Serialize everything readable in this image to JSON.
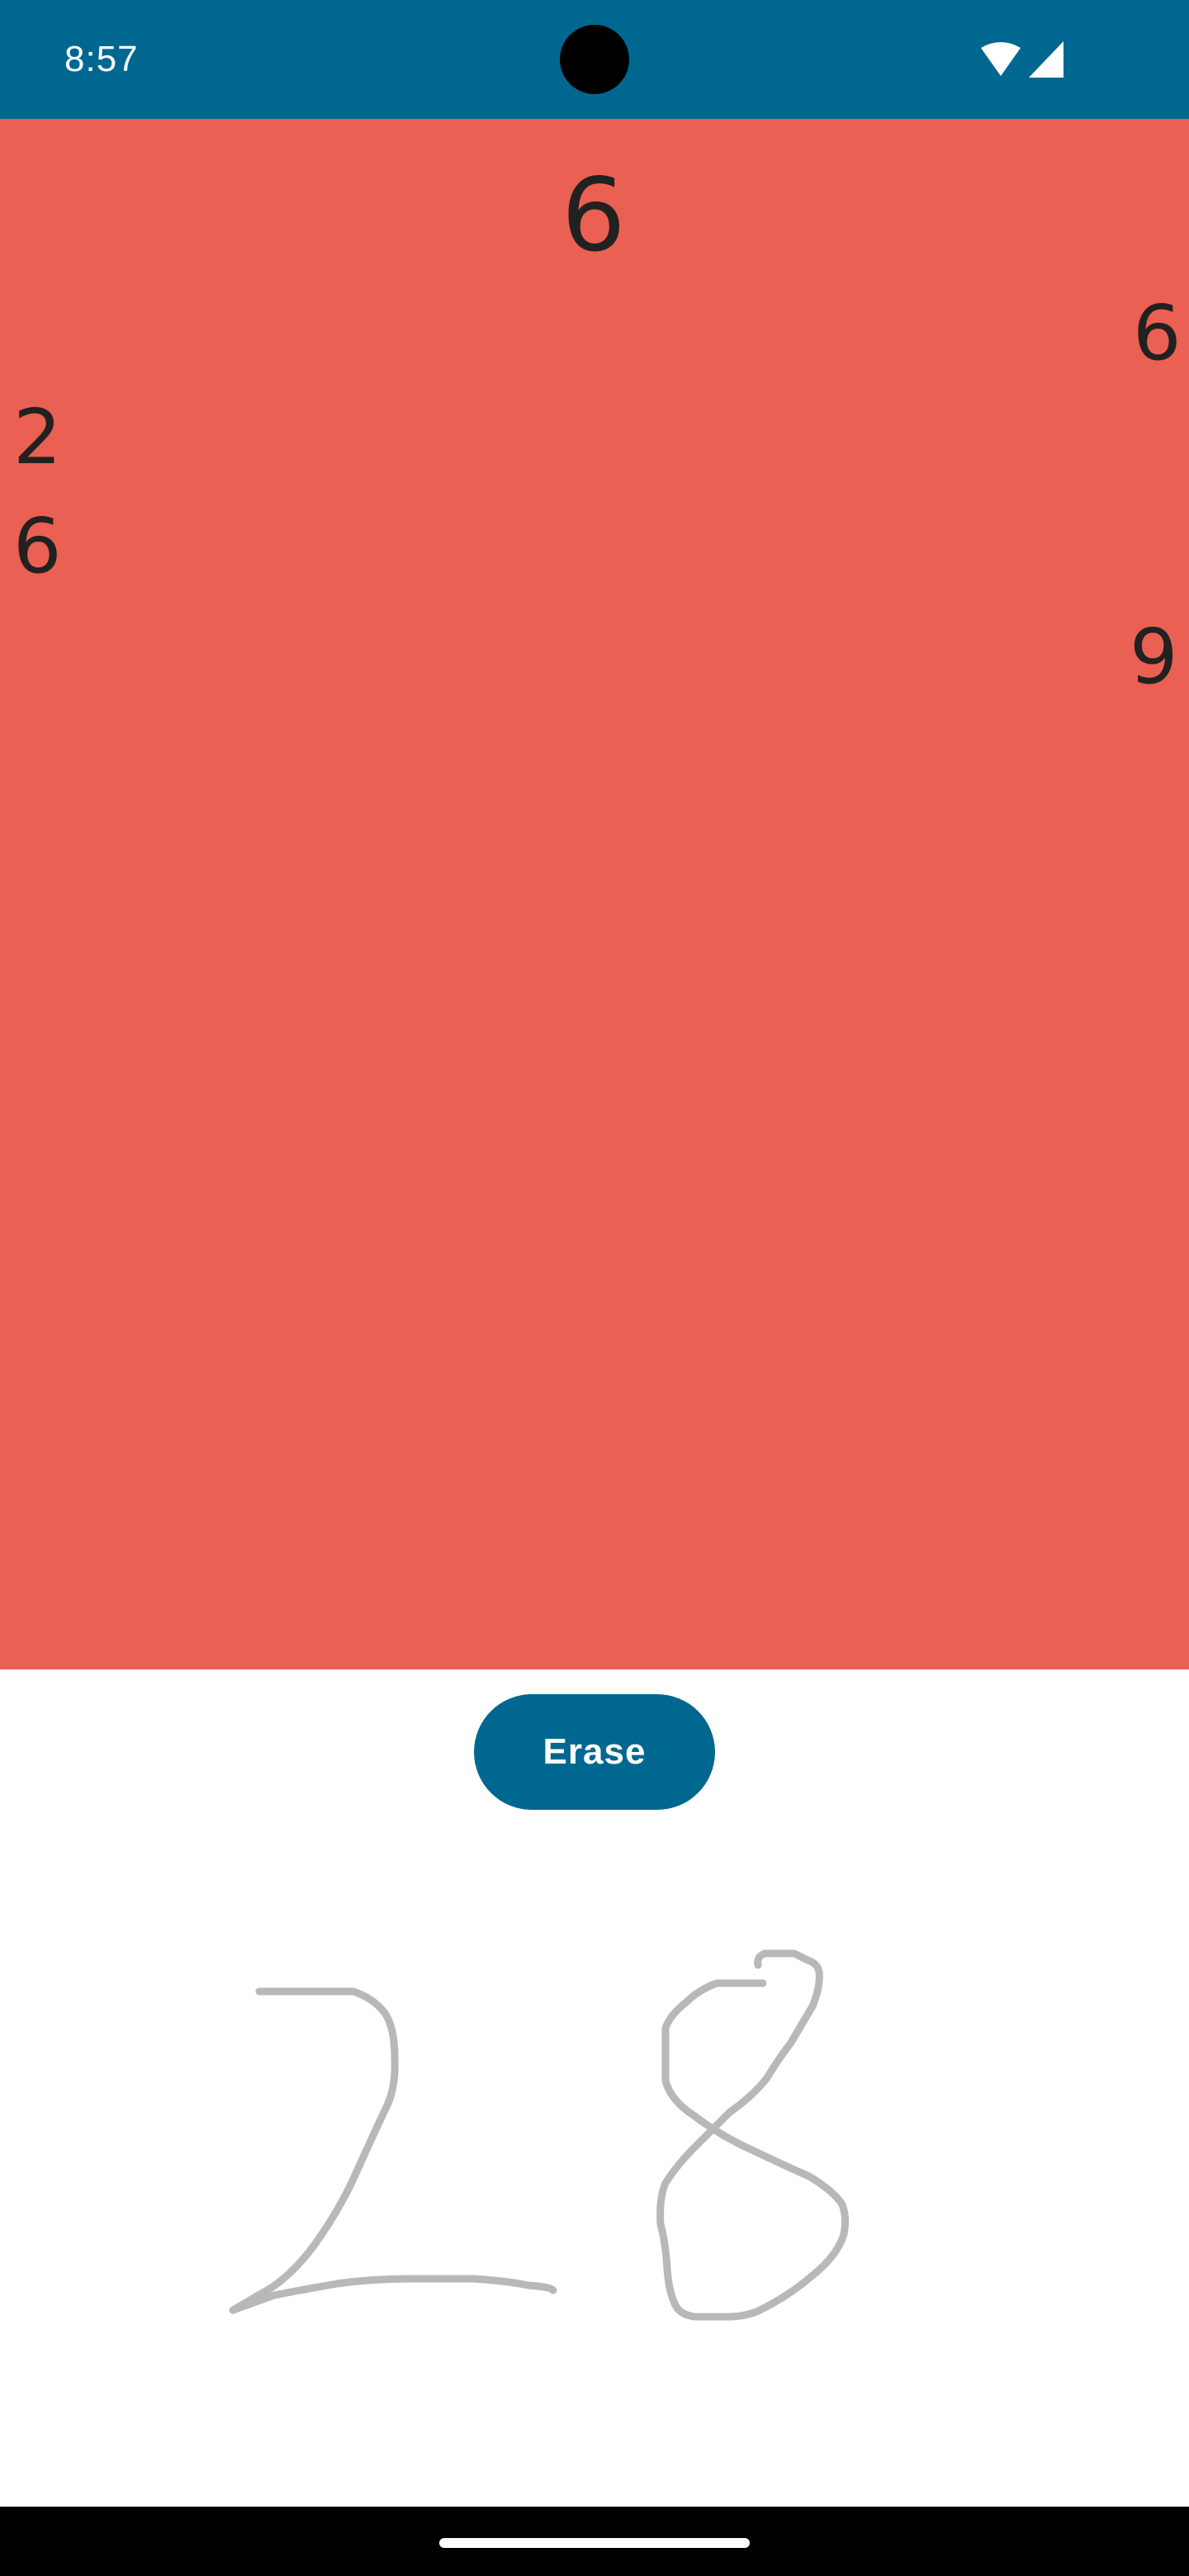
{
  "status_bar": {
    "time": "8:57",
    "background": "#006890",
    "icons": [
      "wifi-icon",
      "cellular-signal-icon"
    ]
  },
  "result_area": {
    "background": "#ea6052",
    "prediction": "6",
    "candidates": [
      "6",
      "2",
      "6",
      "9"
    ]
  },
  "erase_button": {
    "label": "Erase",
    "color": "#006890"
  },
  "drawing": {
    "stroke_color": "#b8b8b8",
    "handwritten_content": "28"
  }
}
